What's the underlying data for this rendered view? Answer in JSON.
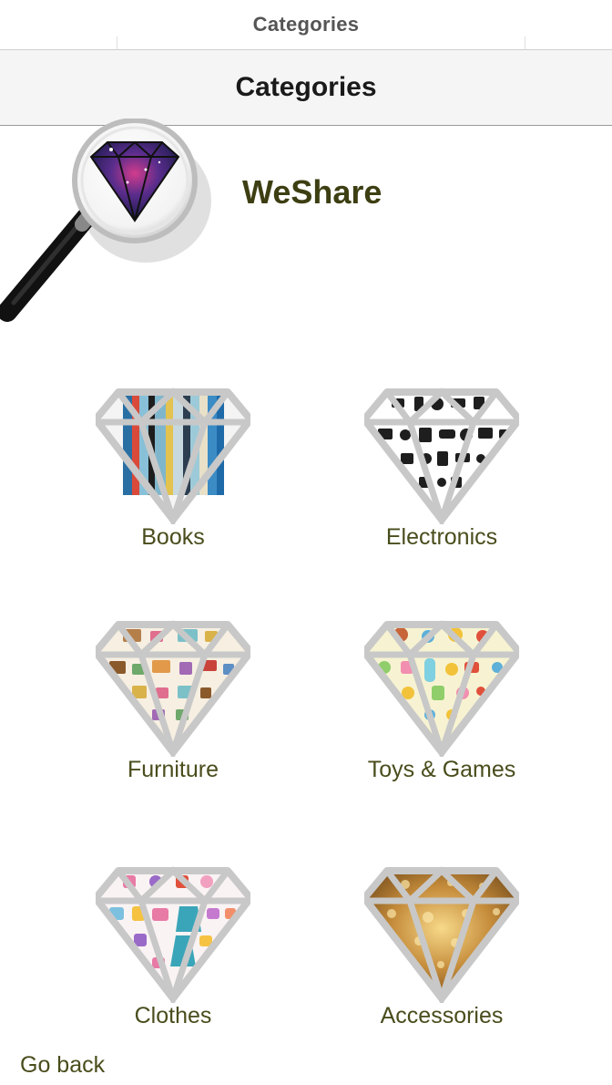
{
  "status_bar": {
    "title": "Categories"
  },
  "nav_bar": {
    "title": "Categories"
  },
  "brand": {
    "name": "WeShare"
  },
  "categories": [
    {
      "label": "Books",
      "icon": "books-diamond-icon"
    },
    {
      "label": "Electronics",
      "icon": "electronics-diamond-icon"
    },
    {
      "label": "Furniture",
      "icon": "furniture-diamond-icon"
    },
    {
      "label": "Toys & Games",
      "icon": "toys-diamond-icon"
    },
    {
      "label": "Clothes",
      "icon": "clothes-diamond-icon"
    },
    {
      "label": "Accessories",
      "icon": "accessories-diamond-icon"
    }
  ],
  "footer": {
    "go_back": "Go back"
  },
  "colors": {
    "label": "#4a4d1c",
    "brand": "#3d3f13",
    "diamond_outline": "#c8c8c8"
  }
}
